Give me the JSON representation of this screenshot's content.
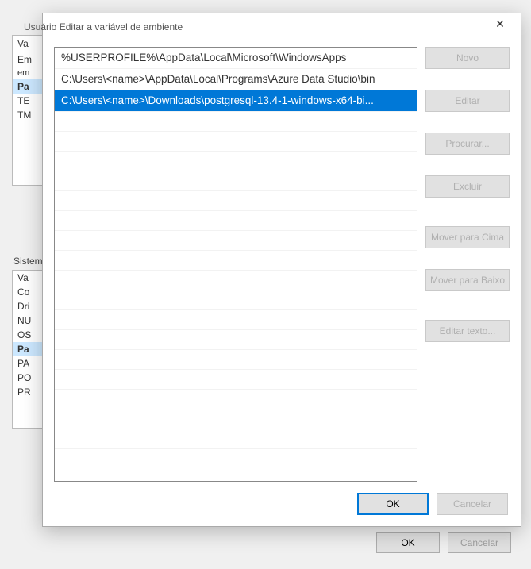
{
  "bg": {
    "user_section_label_partial": "Usuário",
    "system_section_label_partial": "Sistema",
    "header_var": "Va",
    "header_em": "Em",
    "user_vars": [
      "Pa",
      "TE",
      "TM"
    ],
    "sys_vars": [
      "Va",
      "Co",
      "Dri",
      "NU",
      "OS",
      "Pa",
      "PA",
      "PO",
      "PR"
    ],
    "ok_label": "OK",
    "cancel_label": "Cancelar"
  },
  "fg": {
    "title": "Editar a variável de ambiente",
    "paths": [
      "%USERPROFILE%\\AppData\\Local\\Microsoft\\WindowsApps",
      "C:\\Users\\<name>\\AppData\\Local\\Programs\\Azure Data Studio\\bin",
      "C:\\Users\\<name>\\Downloads\\postgresql-13.4-1-windows-x64-bi..."
    ],
    "selected_index": 2,
    "buttons": {
      "novo": "Novo",
      "editar": "Editar",
      "procurar": "Procurar...",
      "excluir": "Excluir",
      "mover_cima": "Mover para Cima",
      "mover_baixo": "Mover para Baixo",
      "editar_texto": "Editar texto..."
    },
    "ok_label": "OK",
    "cancel_label": "Cancelar"
  }
}
